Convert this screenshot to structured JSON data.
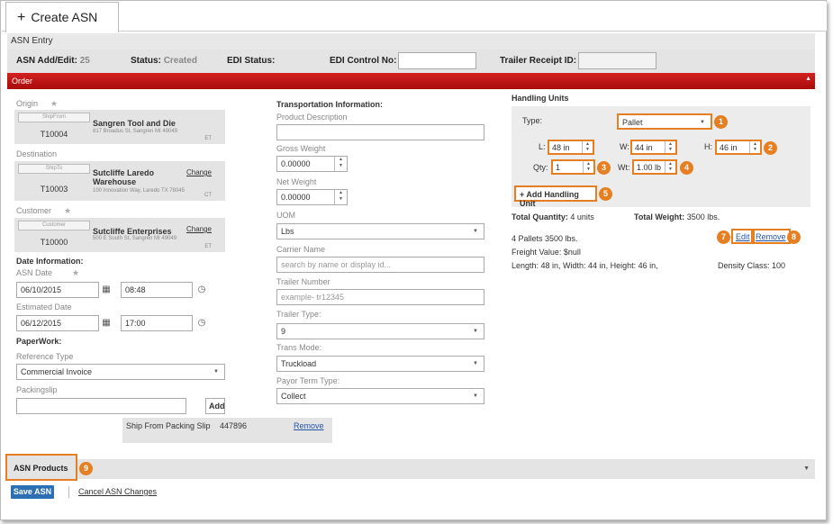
{
  "tab": {
    "label": "Create ASN",
    "icon": "plus-icon"
  },
  "section_title": "ASN Entry",
  "info": {
    "asn_label": "ASN Add/Edit:",
    "asn_value": "25",
    "status_label": "Status:",
    "status_value": "Created",
    "edi_status_label": "EDI Status:",
    "edi_control_label": "EDI Control No:",
    "edi_control_value": "",
    "trailer_receipt_label": "Trailer Receipt ID:",
    "trailer_receipt_value": ""
  },
  "order_bar": {
    "label": "Order"
  },
  "origin": {
    "label": "Origin",
    "tag": "ShipFrom",
    "code": "T10004",
    "name": "Sangren Tool and Die",
    "address": "817 Broadus St, Sangren MI 49049",
    "tz": "ET"
  },
  "destination": {
    "label": "Destination",
    "tag": "ShipTo",
    "code": "T10003",
    "name_line1": "Sutcliffe Laredo",
    "name_line2": "Warehouse",
    "address": "100 Innovation Way, Laredo TX 78045",
    "tz": "CT",
    "change": "Change"
  },
  "customer": {
    "label": "Customer",
    "tag": "Customer",
    "code": "T10000",
    "name": "Sutcliffe Enterprises",
    "address": "500 E South St, Sangren MI 49049",
    "tz": "ET",
    "change": "Change"
  },
  "date_info": {
    "title": "Date Information:",
    "asn_date_label": "ASN Date",
    "asn_date": "06/10/2015",
    "asn_time": "08:48",
    "est_date_label": "Estimated Date",
    "est_date": "06/12/2015",
    "est_time": "17:00"
  },
  "paperwork": {
    "title": "PaperWork:",
    "ref_type_label": "Reference Type",
    "ref_type_value": "Commercial Invoice",
    "packingslip_label": "Packingslip",
    "packingslip_value": "",
    "add_label": "Add",
    "row": {
      "type": "Ship From Packing Slip",
      "number": "447896",
      "remove": "Remove"
    }
  },
  "transport": {
    "title": "Transportation Information:",
    "product_desc_label": "Product Description",
    "product_desc_value": "",
    "gross_weight_label": "Gross Weight",
    "gross_weight_value": "0.00000",
    "net_weight_label": "Net Weight",
    "net_weight_value": "0.00000",
    "uom_label": "UOM",
    "uom_value": "Lbs",
    "carrier_label": "Carrier Name",
    "carrier_placeholder": "search by name or display id...",
    "trailer_num_label": "Trailer Number",
    "trailer_num_placeholder": "example- tr12345",
    "trailer_type_label": "Trailer Type:",
    "trailer_type_value": "9",
    "trans_mode_label": "Trans Mode:",
    "trans_mode_value": "Truckload",
    "payor_label": "Payor Term Type:",
    "payor_value": "Collect"
  },
  "handling": {
    "title": "Handling Units",
    "type_label": "Type:",
    "type_value": "Pallet",
    "l_label": "L:",
    "l_value": "48 in",
    "w_label": "W:",
    "w_value": "44 in",
    "h_label": "H:",
    "h_value": "46 in",
    "qty_label": "Qty:",
    "qty_value": "1",
    "wt_label": "Wt:",
    "wt_value": "1.00 lb",
    "add_unit_label": "+ Add Handling Unit",
    "total_qty_label": "Total Quantity:",
    "total_qty_value": "4 units",
    "total_wt_label": "Total Weight:",
    "total_wt_value": "3500 lbs.",
    "summary_line1": "4 Pallets 3500 lbs.",
    "summary_line2": "Freight Value: $null",
    "summary_line3": "Length: 48 in, Width: 44 in, Height: 46 in,",
    "density": "Density Class: 100",
    "edit": "Edit",
    "remove": "Remove"
  },
  "badges": [
    "1",
    "2",
    "3",
    "4",
    "5",
    "6",
    "7",
    "8",
    "9"
  ],
  "products_bar": {
    "label": "ASN Products"
  },
  "footer": {
    "save": "Save ASN",
    "cancel": "Cancel ASN Changes"
  },
  "colors": {
    "accent_red": "#c81414",
    "callout_orange": "#e67e22",
    "save_blue": "#2c6fb5"
  }
}
